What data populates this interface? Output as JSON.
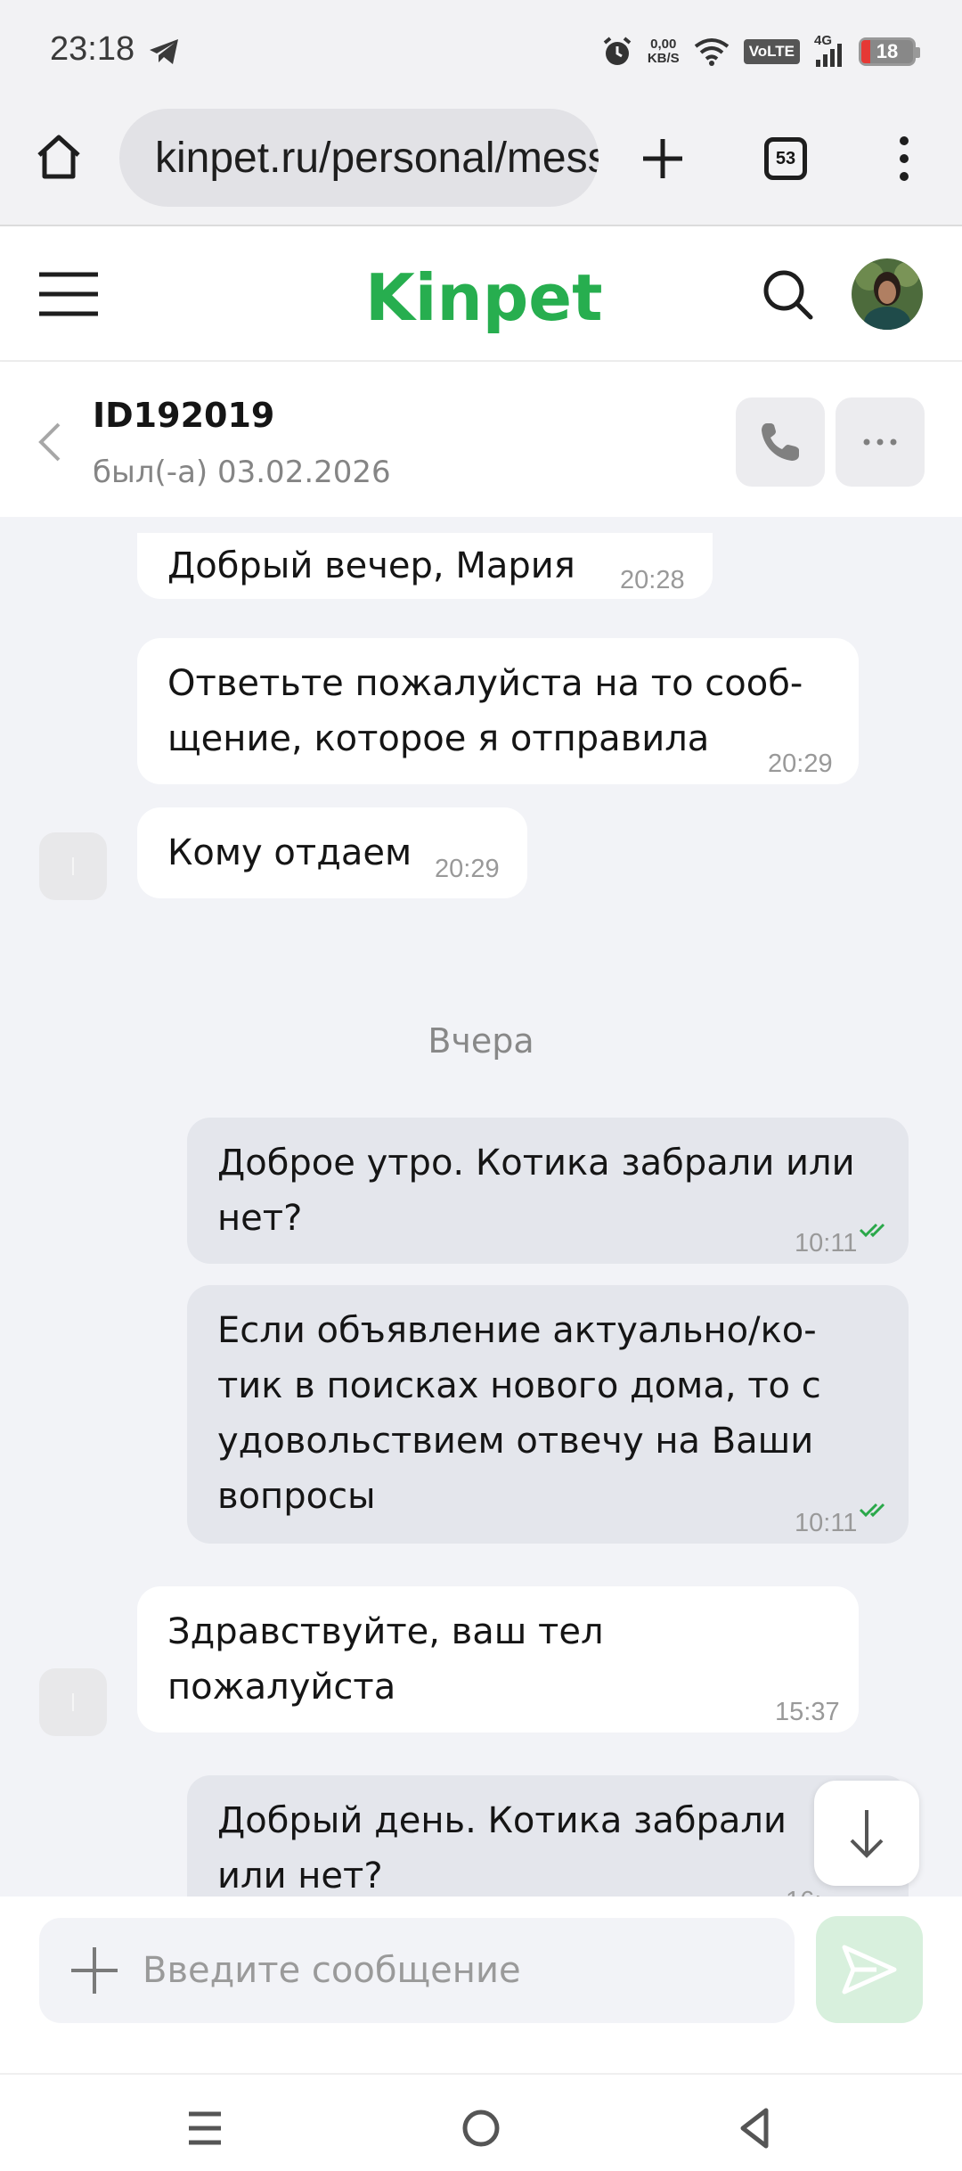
{
  "status_bar": {
    "time": "23:18",
    "net_speed_value": "0,00",
    "net_speed_unit": "KB/S",
    "volte": "VoLTE",
    "network": "4G",
    "battery_level": "18",
    "icons": [
      "telegram-icon",
      "alarm-icon",
      "wifi-icon",
      "signal-icon",
      "battery-icon"
    ]
  },
  "browser": {
    "url": "kinpet.ru/personal/messages",
    "tab_count": "53"
  },
  "site": {
    "logo": "Kinpet"
  },
  "chat": {
    "title": "ID192019",
    "status": "был(-а) 03.02.2026"
  },
  "messages": [
    {
      "direction": "in",
      "lines": [
        "Добрый вечер, Мария"
      ],
      "time": "20:28"
    },
    {
      "direction": "in",
      "lines": [
        "Ответьте пожалуйста на то сооб-",
        "щение, которое я отправила"
      ],
      "time": "20:29"
    },
    {
      "direction": "in",
      "lines": [
        "Кому отдаем"
      ],
      "time": "20:29"
    },
    {
      "direction": "out",
      "lines": [
        "Доброе утро. Котика забрали или",
        "нет?"
      ],
      "time": "10:11",
      "read": true
    },
    {
      "direction": "out",
      "lines": [
        "Если объявление актуально/ко-",
        "тик в поисках нового дома, то с",
        "удовольствием отвечу на Ваши",
        "вопросы"
      ],
      "time": "10:11",
      "read": true
    },
    {
      "direction": "in",
      "lines": [
        "Здравствуйте, ваш тел",
        "пожалуйста"
      ],
      "time": "15:37"
    },
    {
      "direction": "out",
      "lines": [
        "Добрый день. Котика забрали",
        "или нет?"
      ],
      "time": "16:"
    }
  ],
  "date_separator": "Вчера",
  "composer": {
    "placeholder": "Введите сообщение"
  },
  "colors": {
    "brand": "#27ae4f",
    "read_check": "#2aa84a",
    "send_button_bg": "#d8f0dd"
  }
}
